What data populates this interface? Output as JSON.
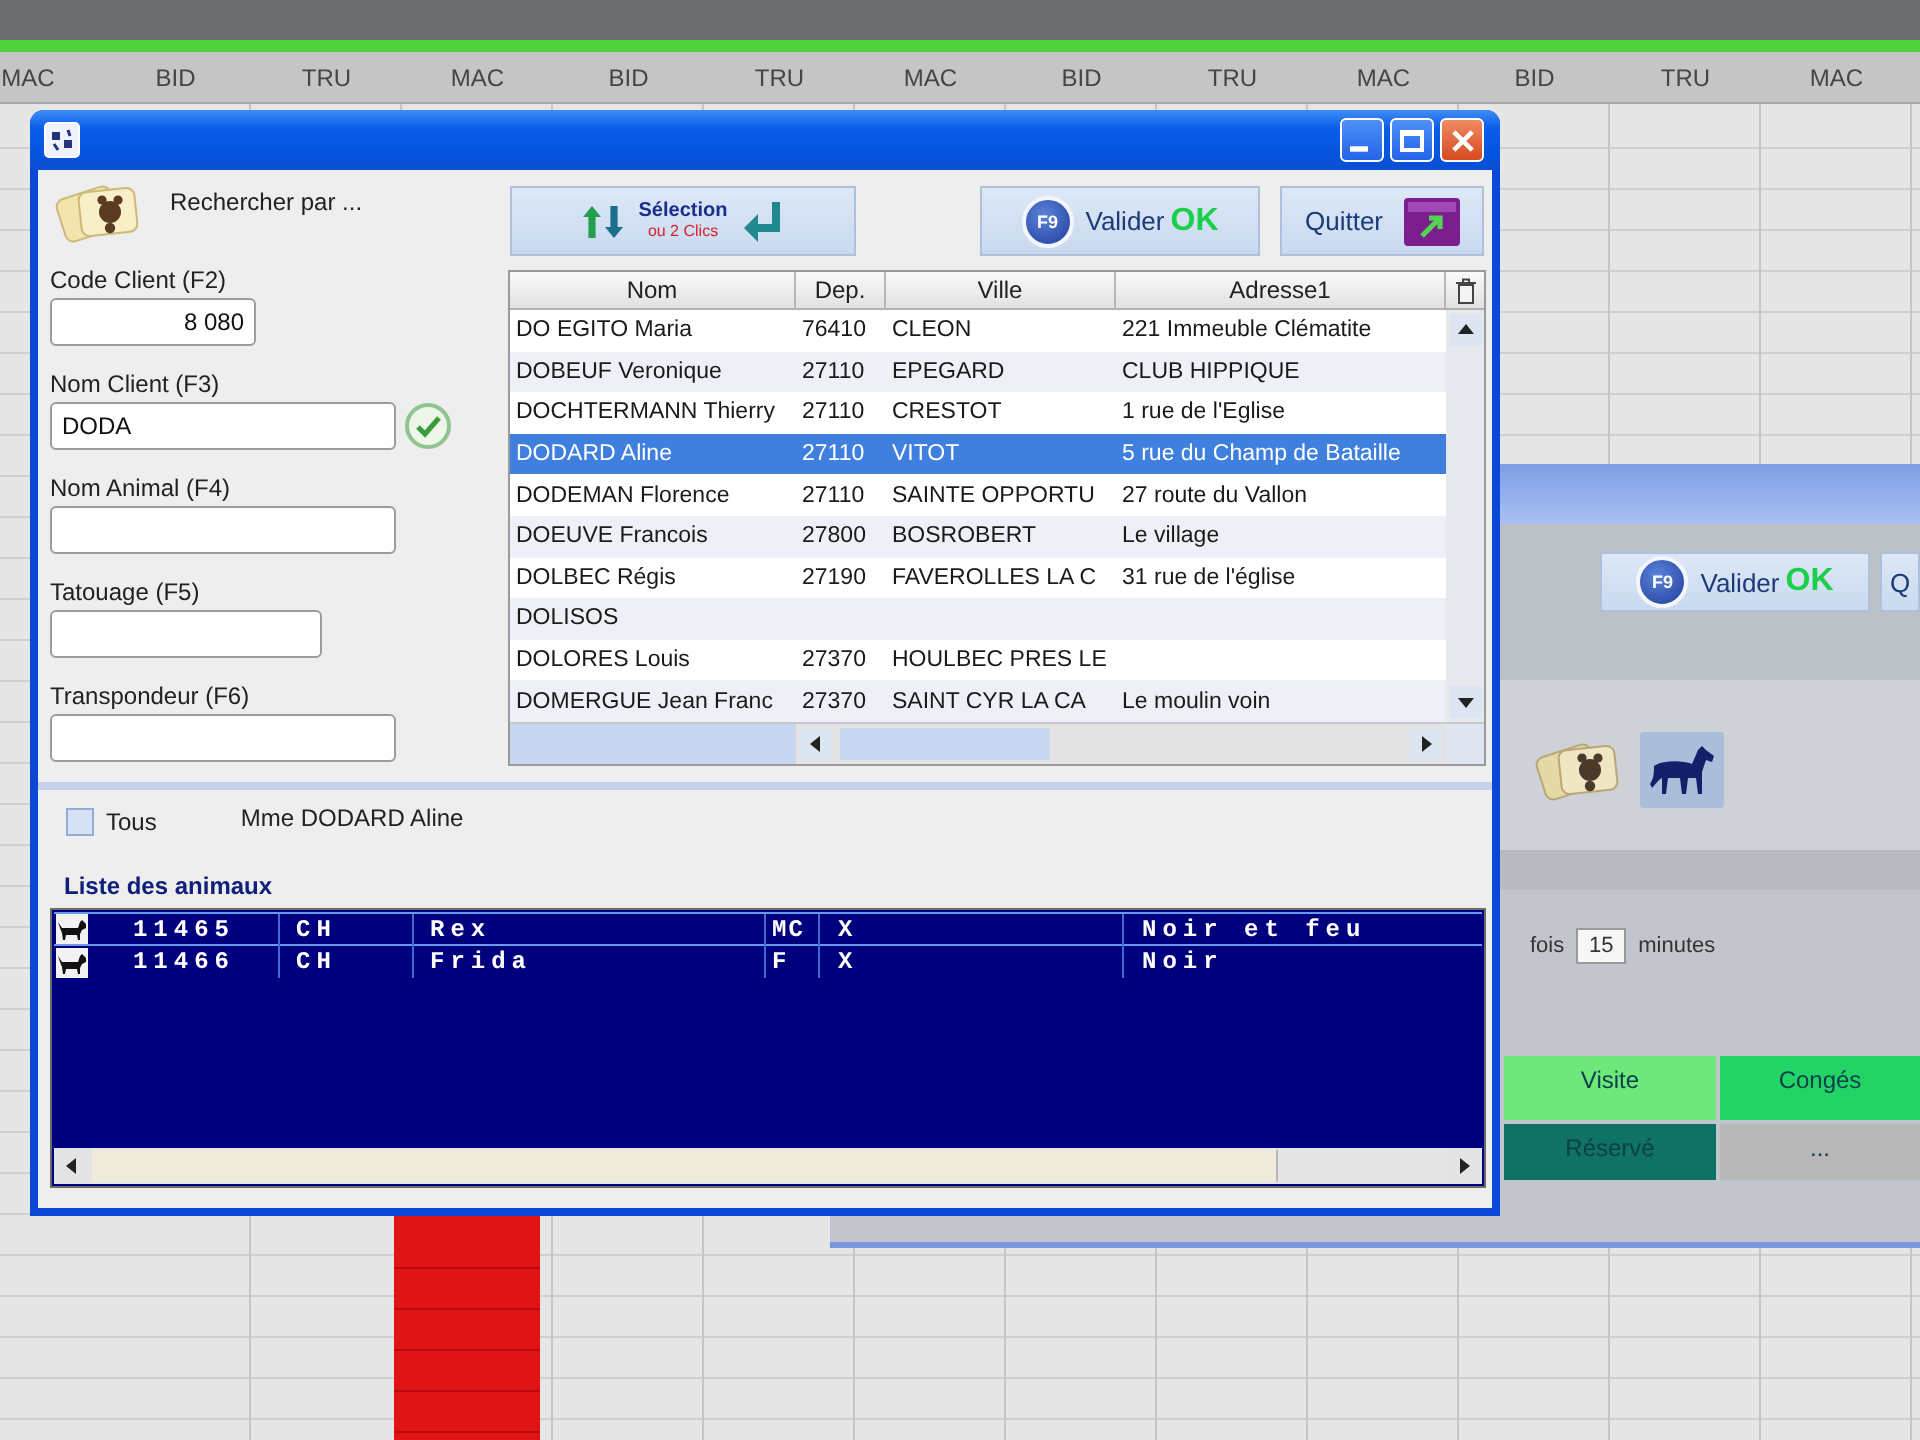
{
  "schedule": {
    "columns": [
      "MAC",
      "BID",
      "TRU",
      "MAC",
      "BID",
      "TRU",
      "MAC",
      "BID",
      "TRU",
      "MAC",
      "BID",
      "TRU",
      "MAC"
    ]
  },
  "dialog": {
    "search_title": "Rechercher par ...",
    "fields": [
      {
        "label": "Code Client (F2)",
        "value": "8 080",
        "kind": "number",
        "verified": false
      },
      {
        "label": "Nom Client (F3)",
        "value": "DODA",
        "kind": "text",
        "verified": true
      },
      {
        "label": "Nom Animal (F4)",
        "kind": "text",
        "verified": false
      },
      {
        "label": "Tatouage (F5)",
        "kind": "text",
        "verified": false
      },
      {
        "label": "Transpondeur (F6)",
        "kind": "text",
        "verified": false
      }
    ],
    "selection_button": {
      "title": "Sélection",
      "subtitle": "ou 2 Clics"
    },
    "validate_button": {
      "key": "F9",
      "label": "Valider",
      "ok": "OK"
    },
    "quit_button": {
      "label": "Quitter"
    },
    "clients_table": {
      "columns": [
        "Nom",
        "Dep.",
        "Ville",
        "Adresse1"
      ],
      "rows": [
        {
          "cells": [
            "DO EGITO Maria",
            "76410",
            "CLEON",
            "221 Immeuble Clématite"
          ],
          "selected": false
        },
        {
          "cells": [
            "DOBEUF Veronique",
            "27110",
            "EPEGARD",
            "CLUB HIPPIQUE"
          ],
          "selected": false
        },
        {
          "cells": [
            "DOCHTERMANN Thierry",
            "27110",
            "CRESTOT",
            "1 rue de l'Eglise"
          ],
          "selected": false
        },
        {
          "cells": [
            "DODARD Aline",
            "27110",
            "VITOT",
            "5 rue du Champ de Bataille"
          ],
          "selected": true
        },
        {
          "cells": [
            "DODEMAN Florence",
            "27110",
            "SAINTE OPPORTU",
            "27 route du Vallon"
          ],
          "selected": false
        },
        {
          "cells": [
            "DOEUVE Francois",
            "27800",
            "BOSROBERT",
            "Le village"
          ],
          "selected": false
        },
        {
          "cells": [
            "DOLBEC Régis",
            "27190",
            "FAVEROLLES LA C",
            "31 rue de l'église"
          ],
          "selected": false
        },
        {
          "cells": [
            "DOLISOS"
          ],
          "selected": false
        },
        {
          "cells": [
            "DOLORES Louis",
            "27370",
            "HOULBEC PRES LE"
          ],
          "selected": false
        },
        {
          "cells": [
            "DOMERGUE Jean Franc",
            "27370",
            "SAINT CYR LA CA",
            "Le moulin voin"
          ],
          "selected": false
        }
      ]
    },
    "all_animals": {
      "label": "Tous",
      "checked": false
    },
    "owner": "Mme DODARD Aline",
    "animals": {
      "title": "Liste des animaux",
      "rows": [
        {
          "cells": [
            "11465",
            "CH",
            "Rex",
            "MC",
            "X",
            "Noir et feu"
          ],
          "selected": true
        },
        {
          "cells": [
            "11466",
            "CH",
            "Frida",
            "F",
            "X",
            "Noir"
          ],
          "selected": false
        }
      ]
    }
  },
  "back_window": {
    "validate_button": {
      "key": "F9",
      "label": "Valider",
      "ok": "OK"
    },
    "quit_button": {
      "label": "Q"
    },
    "interval": {
      "prefix": "fois",
      "value": "15",
      "suffix": "minutes"
    },
    "legend": [
      {
        "label": "Visite",
        "color": "#6ee87a"
      },
      {
        "label": "Congés",
        "color": "#22d466"
      },
      {
        "label": "Réservé",
        "color": "#0f7262"
      },
      {
        "label": "...",
        "color": "#b8b8b8"
      }
    ]
  }
}
